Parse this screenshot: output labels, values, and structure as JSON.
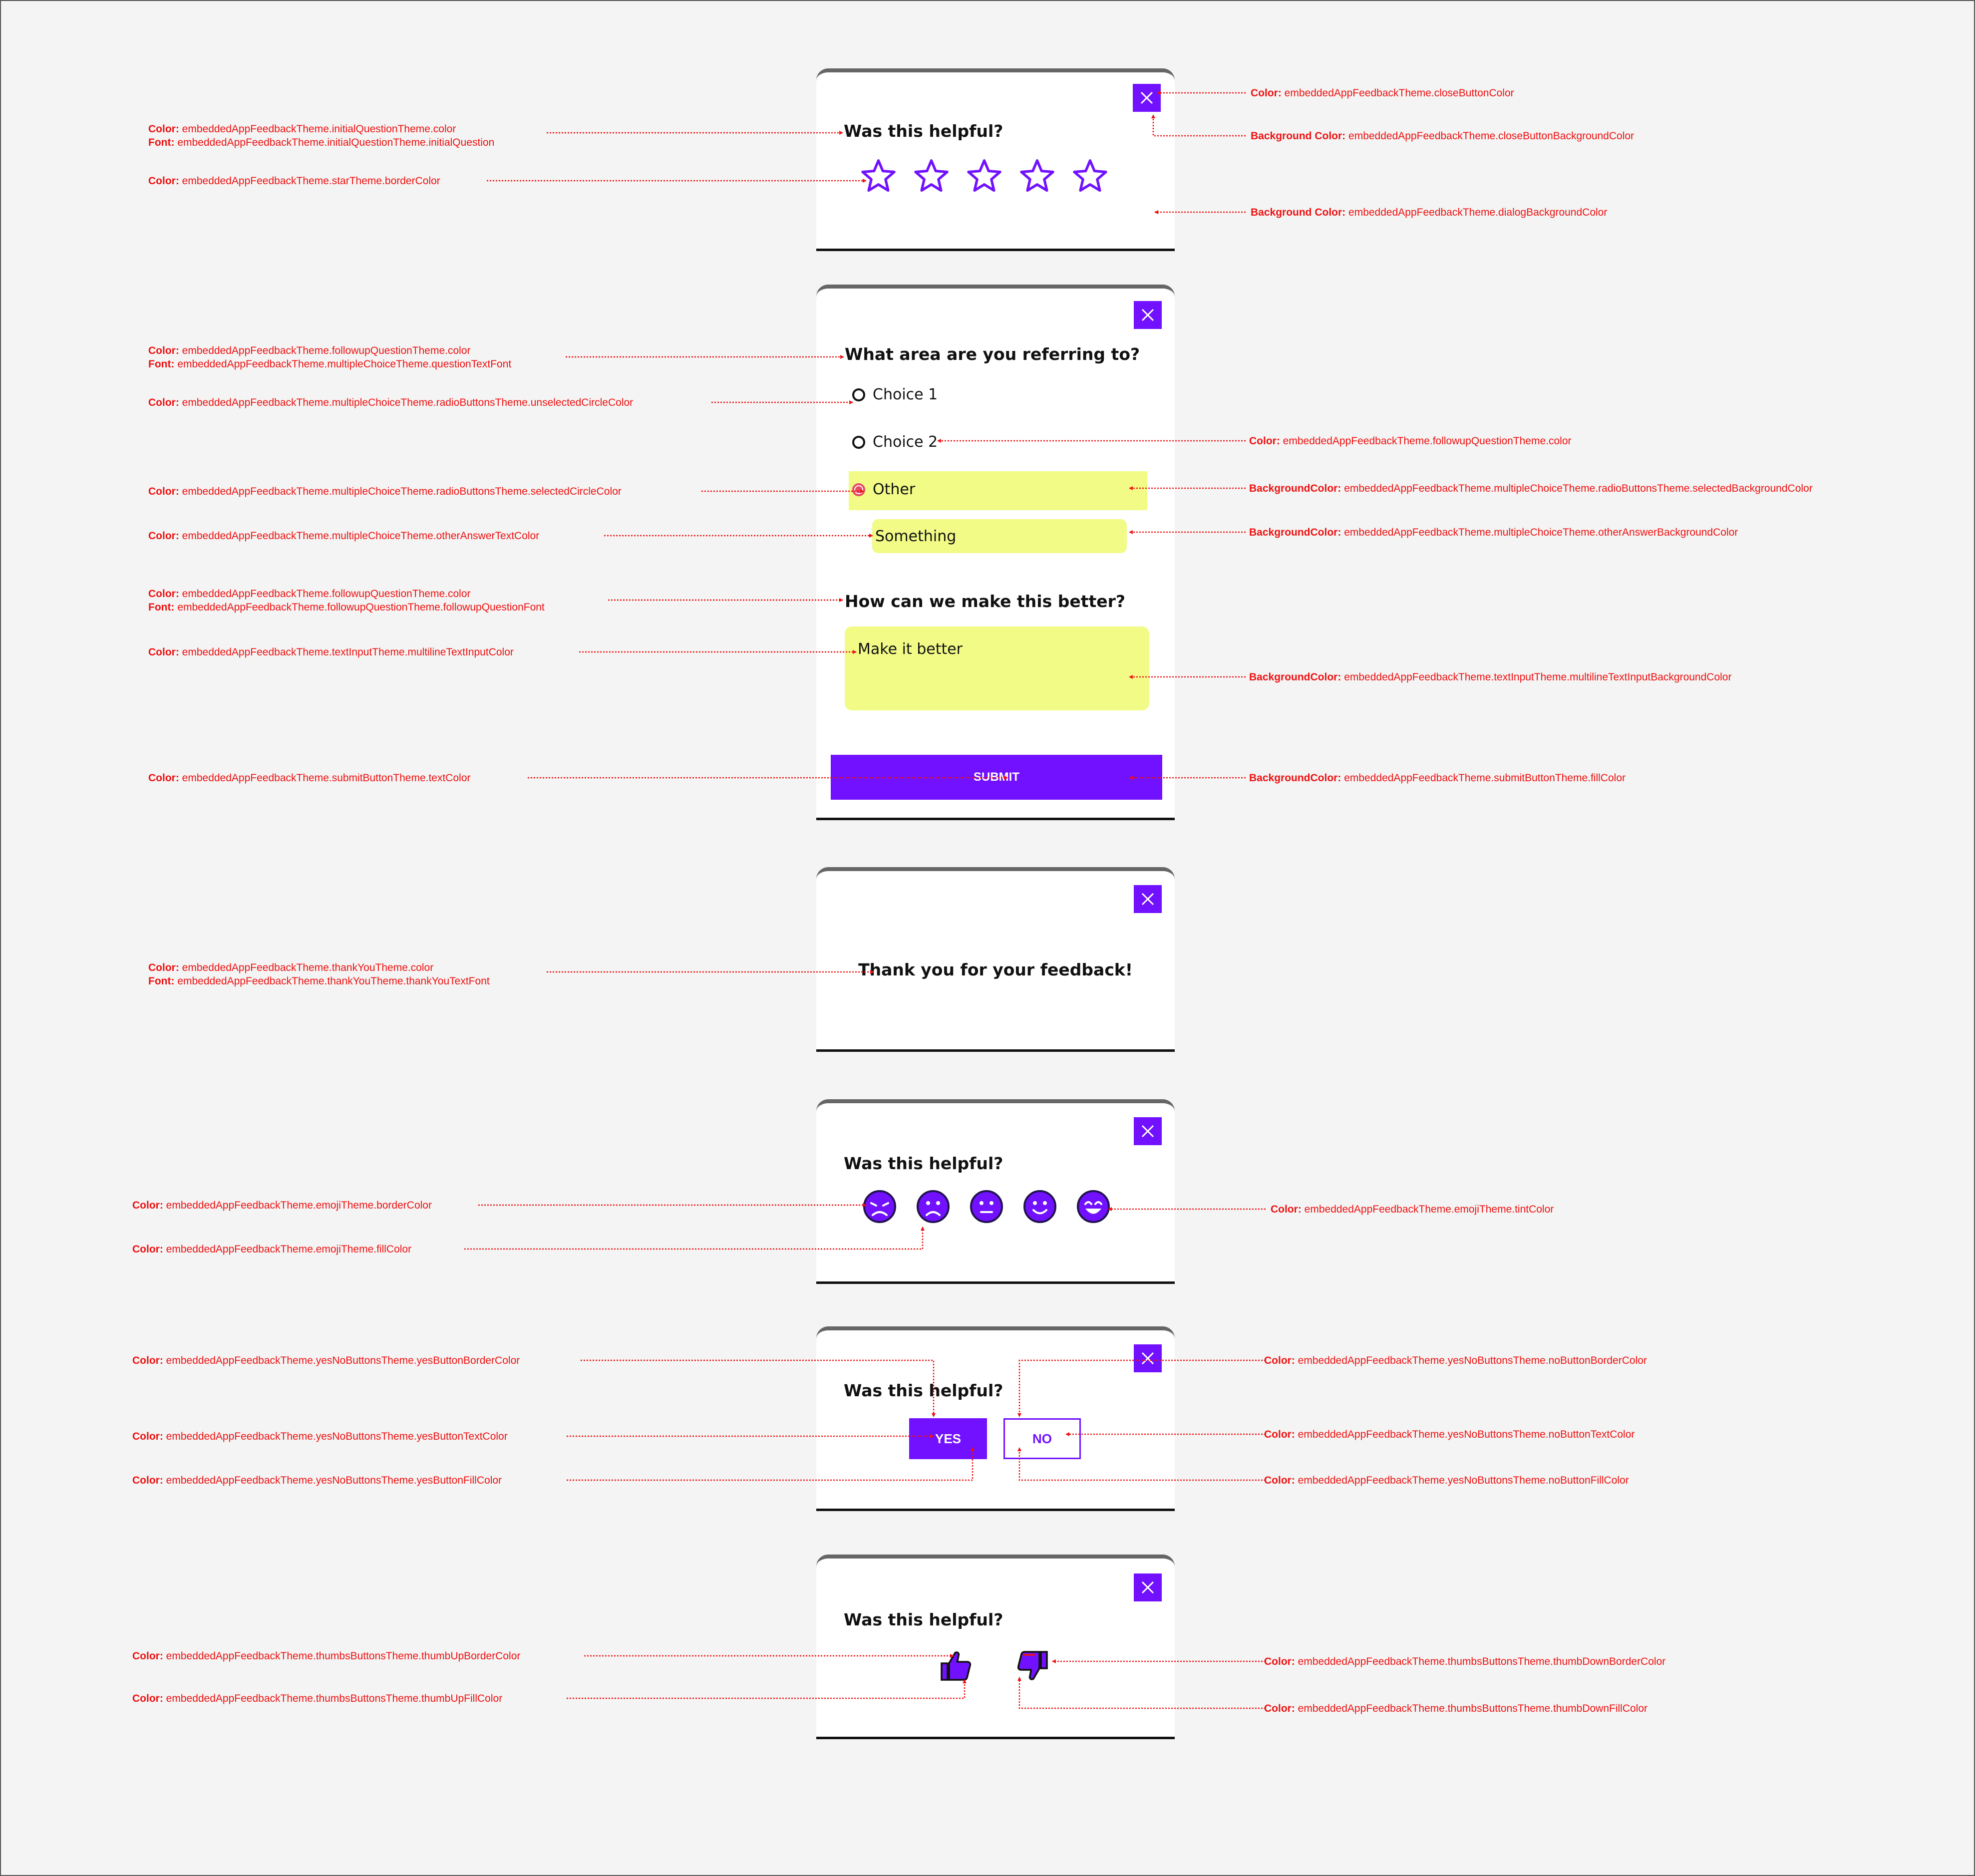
{
  "colors": {
    "accent": "#7111ff",
    "annotation": "#ee1111",
    "highlight": "#f1fb86",
    "selected_radio": "#e64a64"
  },
  "card_star": {
    "question": "Was this helpful?",
    "close_icon": "close-icon",
    "star_icon": "star-outline-icon",
    "star_count": 5
  },
  "card_multi": {
    "question": "What area are you referring to?",
    "choices": [
      "Choice 1",
      "Choice 2",
      "Other"
    ],
    "selected_choice": "Other",
    "other_answer": "Something",
    "followup_question": "How can we make this better?",
    "multiline_value": "Make it better",
    "submit_label": "SUBMIT"
  },
  "card_thanks": {
    "message": "Thank you for your feedback!"
  },
  "card_emoji": {
    "question": "Was this helpful?",
    "emoji_icons": [
      "very-sad-emoji-icon",
      "sad-emoji-icon",
      "neutral-emoji-icon",
      "happy-emoji-icon",
      "very-happy-emoji-icon"
    ]
  },
  "card_yesno": {
    "question": "Was this helpful?",
    "yes_label": "YES",
    "no_label": "NO"
  },
  "card_thumbs": {
    "question": "Was this helpful?",
    "thumb_up_icon": "thumb-up-icon",
    "thumb_down_icon": "thumb-down-icon"
  },
  "annotations": {
    "initial_q": {
      "k1": "Color:",
      "v1": "embeddedAppFeedbackTheme.initialQuestionTheme.color",
      "k2": "Font:",
      "v2": "embeddedAppFeedbackTheme.initialQuestionTheme.initialQuestion"
    },
    "star_border": {
      "k1": "Color:",
      "v1": "embeddedAppFeedbackTheme.starTheme.borderColor"
    },
    "close_color": {
      "k1": "Color:",
      "v1": "embeddedAppFeedbackTheme.closeButtonColor"
    },
    "close_bg": {
      "k1": "Background Color:",
      "v1": "embeddedAppFeedbackTheme.closeButtonBackgroundColor"
    },
    "dialog_bg": {
      "k1": "Background Color:",
      "v1": "embeddedAppFeedbackTheme.dialogBackgroundColor"
    },
    "followup_q": {
      "k1": "Color:",
      "v1": "embeddedAppFeedbackTheme.followupQuestionTheme.color",
      "k2": "Font:",
      "v2": "embeddedAppFeedbackTheme.multipleChoiceTheme.questionTextFont"
    },
    "unselected_circle": {
      "k1": "Color:",
      "v1": "embeddedAppFeedbackTheme.multipleChoiceTheme.radioButtonsTheme.unselectedCircleColor"
    },
    "choice2_color": {
      "k1": "Color:",
      "v1": "embeddedAppFeedbackTheme.followupQuestionTheme.color"
    },
    "selected_circle": {
      "k1": "Color:",
      "v1": "embeddedAppFeedbackTheme.multipleChoiceTheme.radioButtonsTheme.selectedCircleColor"
    },
    "selected_bg": {
      "k1": "BackgroundColor:",
      "v1": "embeddedAppFeedbackTheme.multipleChoiceTheme.radioButtonsTheme.selectedBackgroundColor"
    },
    "other_text": {
      "k1": "Color:",
      "v1": "embeddedAppFeedbackTheme.multipleChoiceTheme.otherAnswerTextColor"
    },
    "other_bg": {
      "k1": "BackgroundColor:",
      "v1": "embeddedAppFeedbackTheme.multipleChoiceTheme.otherAnswerBackgroundColor"
    },
    "followup_q2": {
      "k1": "Color:",
      "v1": "embeddedAppFeedbackTheme.followupQuestionTheme.color",
      "k2": "Font:",
      "v2": "embeddedAppFeedbackTheme.followupQuestionTheme.followupQuestionFont"
    },
    "multiline_color": {
      "k1": "Color:",
      "v1": "embeddedAppFeedbackTheme.textInputTheme.multilineTextInputColor"
    },
    "multiline_bg": {
      "k1": "BackgroundColor:",
      "v1": "embeddedAppFeedbackTheme.textInputTheme.multilineTextInputBackgroundColor"
    },
    "submit_text": {
      "k1": "Color:",
      "v1": "embeddedAppFeedbackTheme.submitButtonTheme.textColor"
    },
    "submit_fill": {
      "k1": "BackgroundColor:",
      "v1": "embeddedAppFeedbackTheme.submitButtonTheme.fillColor"
    },
    "thanks": {
      "k1": "Color:",
      "v1": "embeddedAppFeedbackTheme.thankYouTheme.color",
      "k2": "Font:",
      "v2": "embeddedAppFeedbackTheme.thankYouTheme.thankYouTextFont"
    },
    "emoji_border": {
      "k1": "Color:",
      "v1": "embeddedAppFeedbackTheme.emojiTheme.borderColor"
    },
    "emoji_fill": {
      "k1": "Color:",
      "v1": "embeddedAppFeedbackTheme.emojiTheme.fillColor"
    },
    "emoji_tint": {
      "k1": "Color:",
      "v1": "embeddedAppFeedbackTheme.emojiTheme.tintColor"
    },
    "yes_border": {
      "k1": "Color:",
      "v1": "embeddedAppFeedbackTheme.yesNoButtonsTheme.yesButtonBorderColor"
    },
    "yes_text": {
      "k1": "Color:",
      "v1": "embeddedAppFeedbackTheme.yesNoButtonsTheme.yesButtonTextColor"
    },
    "yes_fill": {
      "k1": "Color:",
      "v1": "embeddedAppFeedbackTheme.yesNoButtonsTheme.yesButtonFillColor"
    },
    "no_border": {
      "k1": "Color:",
      "v1": "embeddedAppFeedbackTheme.yesNoButtonsTheme.noButtonBorderColor"
    },
    "no_text": {
      "k1": "Color:",
      "v1": "embeddedAppFeedbackTheme.yesNoButtonsTheme.noButtonTextColor"
    },
    "no_fill": {
      "k1": "Color:",
      "v1": "embeddedAppFeedbackTheme.yesNoButtonsTheme.noButtonFillColor"
    },
    "thumb_up_border": {
      "k1": "Color:",
      "v1": "embeddedAppFeedbackTheme.thumbsButtonsTheme.thumbUpBorderColor"
    },
    "thumb_up_fill": {
      "k1": "Color:",
      "v1": "embeddedAppFeedbackTheme.thumbsButtonsTheme.thumbUpFillColor"
    },
    "thumb_down_border": {
      "k1": "Color:",
      "v1": "embeddedAppFeedbackTheme.thumbsButtonsTheme.thumbDownBorderColor"
    },
    "thumb_down_fill": {
      "k1": "Color:",
      "v1": "embeddedAppFeedbackTheme.thumbsButtonsTheme.thumbDownFillColor"
    }
  }
}
